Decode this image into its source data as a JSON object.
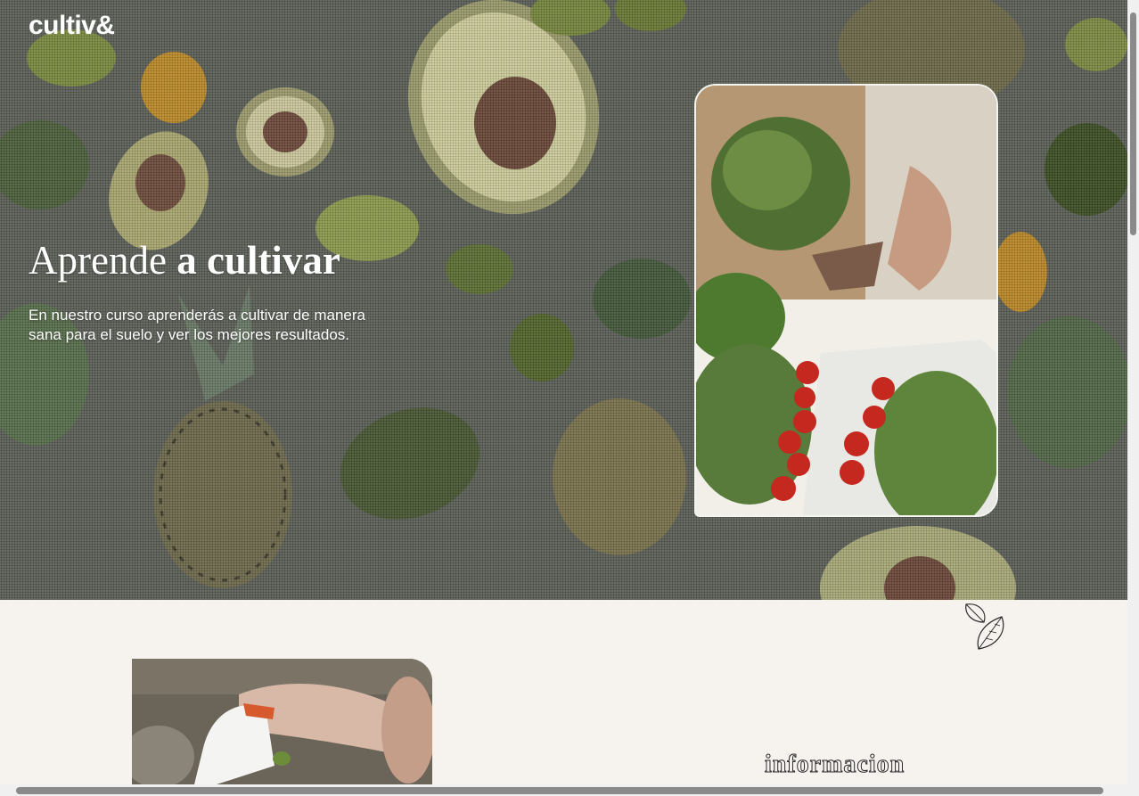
{
  "brand": {
    "name": "cultiv&"
  },
  "hero": {
    "headline_light": "Aprende",
    "headline_bold": "a cultivar",
    "intro": "En nuestro curso aprenderás a cultivar de manera sana para el suelo y ver los mejores resultados."
  },
  "section": {
    "heading": "informacion"
  },
  "icons": {
    "background": "avocados-pineapples-photo",
    "hero_photo": "herbs-and-tomatoes-photo",
    "course_photo": "gloved-hand-planting-photo",
    "decor": "leaves-icon"
  },
  "colors": {
    "page_bg": "#f6f2ee",
    "hero_text": "#ffffff",
    "scroll_thumb": "#8a8a8a"
  }
}
